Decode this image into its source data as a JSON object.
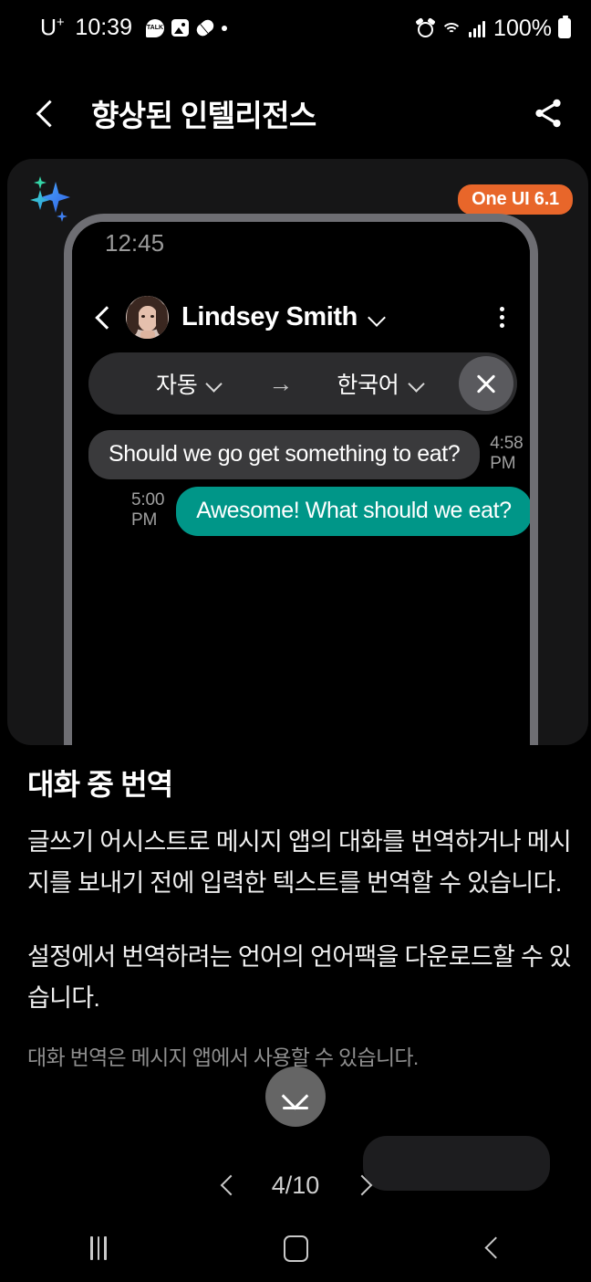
{
  "status_bar": {
    "carrier": "U",
    "carrier_sup": "+",
    "clock": "10:39",
    "battery_text": "100%",
    "icons_left": [
      "kakaotalk-icon",
      "gallery-icon",
      "pill-icon",
      "dot-icon"
    ],
    "icons_right": [
      "alarm-icon",
      "wifi-icon",
      "signal-icon",
      "battery-icon"
    ]
  },
  "app_bar": {
    "back_label": "back-icon",
    "title": "향상된 인텔리전스",
    "share_label": "share-icon"
  },
  "card": {
    "badge": "One UI 6.1",
    "badge_color": "#e8662a",
    "sparkle_icon": "ai-sparkle-icon",
    "phone": {
      "status_time": "12:45",
      "chat": {
        "contact_name": "Lindsey Smith",
        "back_icon": "back-icon",
        "expand_icon": "chevron-down-icon",
        "more_icon": "kebab-menu-icon",
        "avatar": "contact-avatar"
      },
      "translate_bar": {
        "source_language": "자동",
        "arrow": "→",
        "target_language": "한국어",
        "close_label": "close-icon"
      },
      "messages": [
        {
          "direction": "incoming",
          "text": "Should we go get something to eat?",
          "time": "4:58 PM"
        },
        {
          "direction": "outgoing",
          "text": "Awesome! What should we eat?",
          "time": "5:00 PM",
          "color": "#009688"
        }
      ]
    }
  },
  "content": {
    "heading": "대화 중 번역",
    "paragraph_1": "글쓰기 어시스트로 메시지 앱의 대화를 번역하거나 메시지를 보내기 전에 입력한 텍스트를 번역할 수 있습니다.",
    "paragraph_2": "설정에서 번역하려는 언어의 언어팩을 다운로드할 수 있습니다.",
    "note": "대화 번역은 메시지 앱에서 사용할 수 있습니다."
  },
  "scroll_fab": {
    "icon": "scroll-to-bottom-icon"
  },
  "pager": {
    "prev_label": "chevron-left-icon",
    "current_page": "4/10",
    "next_label": "chevron-right-icon"
  },
  "nav_bar": {
    "recents_label": "recents-icon",
    "home_label": "home-icon",
    "back_label": "back-icon"
  }
}
